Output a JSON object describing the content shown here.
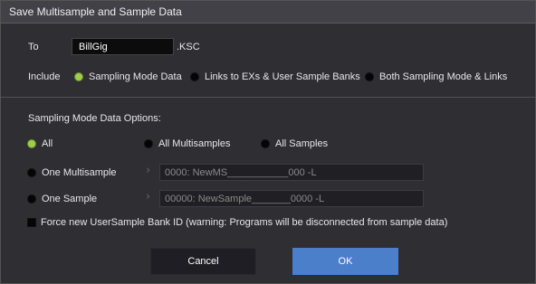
{
  "dialog": {
    "title": "Save Multisample and Sample Data"
  },
  "to": {
    "label": "To",
    "name_value": "BillGig",
    "extension": ".KSC"
  },
  "include": {
    "label": "Include",
    "options": [
      {
        "label": "Sampling Mode Data",
        "selected": true
      },
      {
        "label": "Links to EXs & User Sample Banks",
        "selected": false
      },
      {
        "label": "Both Sampling Mode & Links",
        "selected": false
      }
    ]
  },
  "options_section": {
    "heading": "Sampling Mode Data Options:",
    "all": {
      "label": "All",
      "selected": true
    },
    "all_multisamples": {
      "label": "All Multisamples",
      "selected": false
    },
    "all_samples": {
      "label": "All Samples",
      "selected": false
    },
    "one_multisample": {
      "label": "One Multisample",
      "selected": false,
      "value": "0000: NewMS___________000 -L"
    },
    "one_sample": {
      "label": "One Sample",
      "selected": false,
      "value": "00000: NewSample_______0000 -L"
    }
  },
  "force_new_id": {
    "label": "Force new UserSample Bank ID (warning: Programs will be disconnected from sample data)",
    "checked": false
  },
  "buttons": {
    "cancel": "Cancel",
    "ok": "OK"
  },
  "colors": {
    "accent_selected": "#9fcc49",
    "ok_button": "#4b7fc9",
    "panel": "#2e2e33"
  }
}
